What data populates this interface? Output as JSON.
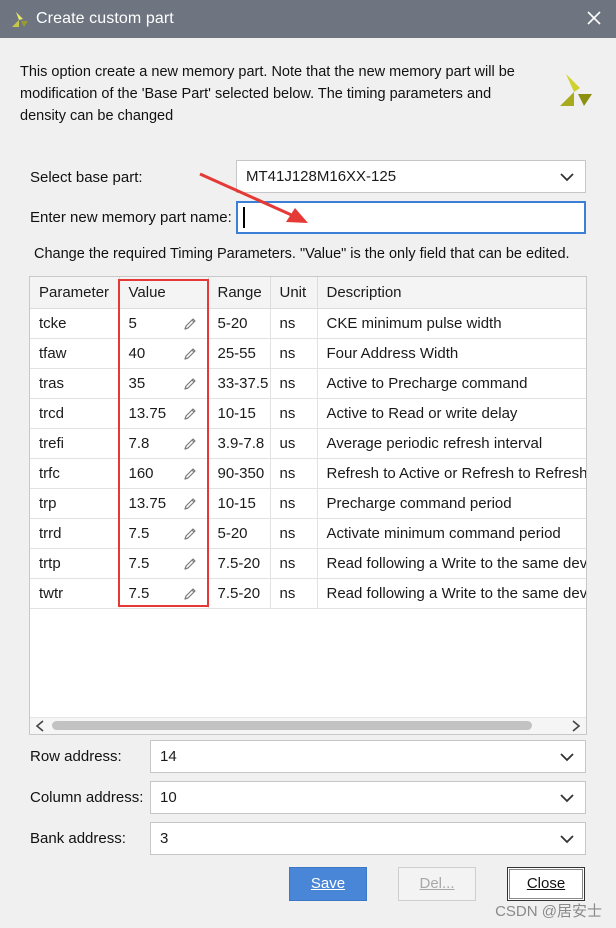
{
  "window": {
    "title": "Create custom part"
  },
  "intro": {
    "text": "This option create a new memory part. Note that the new memory part will be modification of the 'Base Part' selected below. The timing parameters and density can be changed"
  },
  "form": {
    "base_part_label": "Select base part:",
    "base_part_value": "MT41J128M16XX-125",
    "name_label": "Enter new memory part name:",
    "name_value": "",
    "hint": "Change the required Timing Parameters. \"Value\" is the only field that can be edited."
  },
  "table": {
    "headers": [
      "Parameter",
      "Value",
      "Range",
      "Unit",
      "Description"
    ],
    "rows": [
      [
        "tcke",
        "5",
        "5-20",
        "ns",
        "CKE minimum pulse width"
      ],
      [
        "tfaw",
        "40",
        "25-55",
        "ns",
        "Four Address Width"
      ],
      [
        "tras",
        "35",
        "33-37.5",
        "ns",
        "Active to Precharge command"
      ],
      [
        "trcd",
        "13.75",
        "10-15",
        "ns",
        "Active to Read or write delay"
      ],
      [
        "trefi",
        "7.8",
        "3.9-7.8",
        "us",
        "Average periodic refresh interval"
      ],
      [
        "trfc",
        "160",
        "90-350",
        "ns",
        "Refresh to Active or Refresh to Refresh"
      ],
      [
        "trp",
        "13.75",
        "10-15",
        "ns",
        "Precharge command period"
      ],
      [
        "trrd",
        "7.5",
        "5-20",
        "ns",
        "Activate minimum command period"
      ],
      [
        "trtp",
        "7.5",
        "7.5-20",
        "ns",
        "Read following a Write to the same device"
      ],
      [
        "twtr",
        "7.5",
        "7.5-20",
        "ns",
        "Read following a Write to the same device"
      ]
    ]
  },
  "address": {
    "row_label": "Row address:",
    "row_value": "14",
    "column_label": "Column address:",
    "column_value": "10",
    "bank_label": "Bank address:",
    "bank_value": "3"
  },
  "buttons": {
    "save": "Save",
    "del": "Del...",
    "close": "Close"
  },
  "watermark": "CSDN @居安士",
  "colors": {
    "titlebar": "#6e7580",
    "accent": "#4a86d8",
    "highlight": "#e53935",
    "logo": "#b5b800"
  }
}
